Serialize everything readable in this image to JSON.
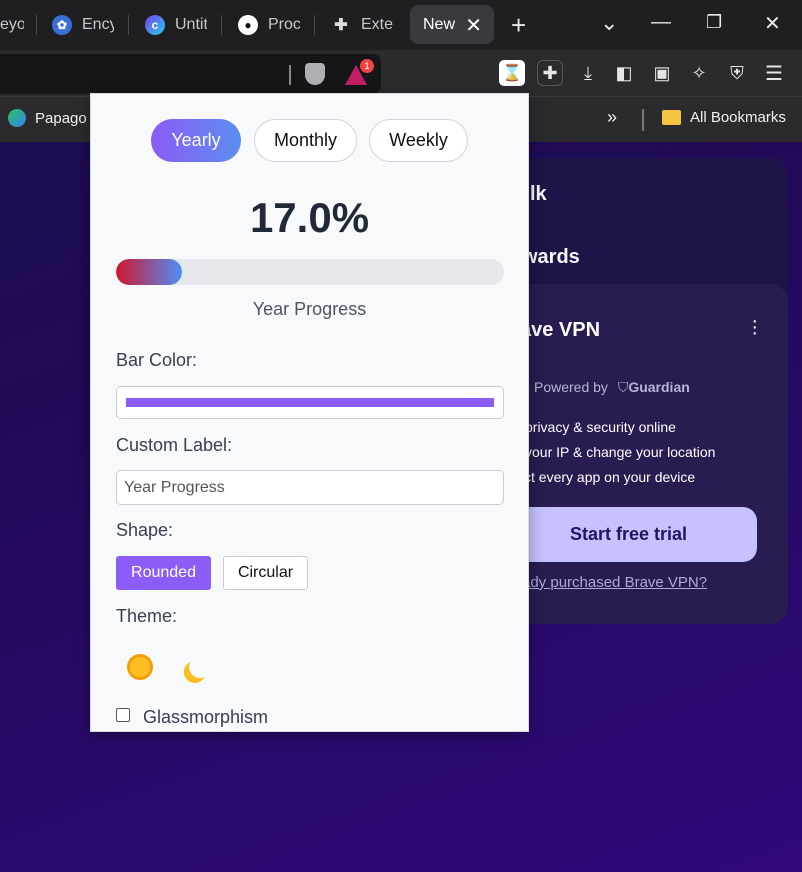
{
  "tabs": [
    {
      "label": "eyo"
    },
    {
      "label": "Ency"
    },
    {
      "label": "Untit"
    },
    {
      "label": "Proc"
    },
    {
      "label": "Exter"
    }
  ],
  "active_tab": {
    "label": "New",
    "close": "✕"
  },
  "window": {
    "new_tab": "+",
    "dropdown": "⌄",
    "minimize": "—",
    "restore": "❐",
    "close": "✕"
  },
  "toolbar": {
    "notification_count": "1"
  },
  "bookmarks": {
    "papago": "Papago",
    "overflow": "»",
    "all": "All Bookmarks"
  },
  "newtab": {
    "row1": "lk",
    "row2": "wards",
    "vpn_title": "ave VPN",
    "vpn_powered": "Powered by",
    "vpn_guardian": "Guardian",
    "features": [
      "privacy & security online",
      "your IP & change your location",
      "ct every app on your device"
    ],
    "cta": "Start free trial",
    "link": "ady purchased Brave VPN?"
  },
  "popup": {
    "periods": [
      "Yearly",
      "Monthly",
      "Weekly"
    ],
    "active_period": "Yearly",
    "percent_text": "17.0%",
    "progress": 0.17,
    "progress_label": "Year Progress",
    "bar_color_label": "Bar Color:",
    "bar_color": "#8b5cf6",
    "custom_label_label": "Custom Label:",
    "custom_label_value": "Year Progress",
    "shape_label": "Shape:",
    "shapes": [
      "Rounded",
      "Circular"
    ],
    "active_shape": "Rounded",
    "theme_label": "Theme:",
    "glass_label": "Glassmorphism",
    "glass_checked": false
  }
}
